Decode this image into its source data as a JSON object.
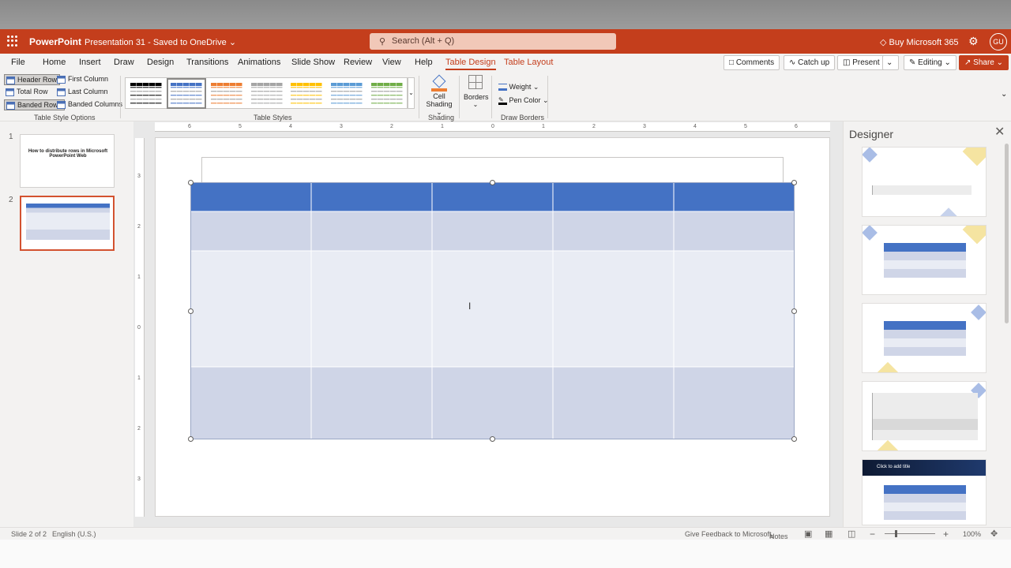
{
  "titlebar": {
    "app_name": "PowerPoint",
    "doc_title": "Presentation 31 - Saved to OneDrive ⌄",
    "search_placeholder": "Search (Alt + Q)",
    "buy": "Buy Microsoft 365",
    "avatar": "GU"
  },
  "tabs": [
    "File",
    "Home",
    "Insert",
    "Draw",
    "Design",
    "Transitions",
    "Animations",
    "Slide Show",
    "Review",
    "View",
    "Help",
    "Table Design",
    "Table Layout"
  ],
  "active_tab": "Table Design",
  "toolbar_buttons": {
    "comments": "Comments",
    "catchup": "Catch up",
    "present": "Present",
    "editing": "Editing ⌄",
    "share": "Share ⌄"
  },
  "ribbon": {
    "options": {
      "header_row": "Header Row",
      "first_column": "First Column",
      "total_row": "Total Row",
      "last_column": "Last Column",
      "banded_rows": "Banded Rows",
      "banded_columns": "Banded Columns",
      "group_label": "Table Style Options"
    },
    "styles_label": "Table Styles",
    "style_colors": [
      "#000000",
      "#4472c4",
      "#ed7d31",
      "#a5a5a5",
      "#ffc000",
      "#5b9bd5",
      "#70ad47"
    ],
    "cell_shading": "Cell Shading ⌄",
    "shading_label": "Shading",
    "borders": "Borders",
    "weight": "Weight ⌄",
    "pen_color": "Pen Color ⌄",
    "draw_borders_label": "Draw Borders"
  },
  "slides": [
    {
      "number": "1",
      "text": "How to distribute rows in Microsoft PowerPoint Web"
    },
    {
      "number": "2"
    }
  ],
  "ruler_h": [
    "6",
    "5",
    "4",
    "3",
    "2",
    "1",
    "0",
    "1",
    "2",
    "3",
    "4",
    "5",
    "6"
  ],
  "ruler_v": [
    "3",
    "2",
    "1",
    "0",
    "1",
    "2",
    "3"
  ],
  "table": {
    "columns": 5,
    "header_color": "#4472c4",
    "band_dark": "#cfd5e7",
    "band_light": "#e9ecf4"
  },
  "designer": {
    "title": "Designer",
    "card5_title": "Click to add title"
  },
  "status": {
    "slide": "Slide 2 of 2",
    "language": "English (U.S.)",
    "feedback": "Give Feedback to Microsoft",
    "notes": "Notes",
    "zoom": "100%"
  }
}
